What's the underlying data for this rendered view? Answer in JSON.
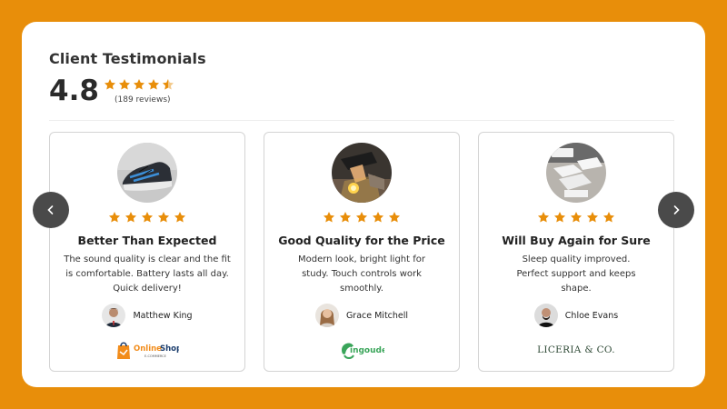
{
  "header": {
    "title": "Client Testimonials",
    "rating_value": "4.8",
    "rating_stars": 4.5,
    "review_count": "(189 reviews)"
  },
  "colors": {
    "background": "#E88E0A",
    "star": "#E88E0A",
    "panel": "#FFFFFF"
  },
  "nav": {
    "prev_icon": "chevron-left-icon",
    "next_icon": "chevron-right-icon"
  },
  "testimonials": [
    {
      "photo": "sneaker-photo",
      "stars": 5,
      "headline": "Better Than Expected",
      "body": "The sound quality is clear and the fit is comfortable. Battery lasts all day. Quick delivery!",
      "author": "Matthew King",
      "brand": {
        "name": "Online Shop",
        "tagline": "E-COMMERCE"
      }
    },
    {
      "photo": "lamp-photo",
      "stars": 5,
      "headline": "Good Quality for the Price",
      "body": "Modern look, bright light for study. Touch controls work smoothly.",
      "author": "Grace Mitchell",
      "brand": {
        "name": "ingoude"
      }
    },
    {
      "photo": "pillow-photo",
      "stars": 5,
      "headline": "Will Buy Again for Sure",
      "body": "Sleep quality improved. Perfect support and keeps shape.",
      "author": "Chloe Evans",
      "brand": {
        "name": "LICERIA & CO."
      }
    }
  ]
}
